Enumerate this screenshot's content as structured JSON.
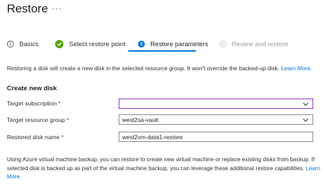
{
  "header": {
    "title": "Restore",
    "more_label": "···"
  },
  "steps": [
    {
      "number": "1",
      "label": "Basics",
      "state": "pending"
    },
    {
      "number": "",
      "label": "Select restore point",
      "state": "done"
    },
    {
      "number": "3",
      "label": "Restore parameters",
      "state": "active"
    },
    {
      "number": "4",
      "label": "Review and restore",
      "state": "disabled"
    }
  ],
  "info": {
    "text": "Restoring a disk will create a new disk in the selected resource group. It won't override the backed-up disk.",
    "link": "Learn More."
  },
  "section": {
    "title": "Create new disk"
  },
  "form": {
    "subscription": {
      "label": "Target subscription",
      "required": "*",
      "value": ""
    },
    "resource_group": {
      "label": "Target resource group",
      "required": "*",
      "value": "west2sa-vault"
    },
    "disk_name": {
      "label": "Restored disk name",
      "required": "*",
      "value": "west2vm-data1-restore"
    }
  },
  "bottom": {
    "text": "Using Azure virtual machine backup, you can restore to create new virtual machine or replace existing disks from backup. If selected disk is backed up as part of the virtual machine backup, you can leverage these additional restore capabilities.",
    "link": "Learn More."
  },
  "colors": {
    "accent": "#0078d4",
    "success": "#57a300",
    "focus": "#8c35c0",
    "required": "#a4262c"
  },
  "icons": {
    "done_step": "checkmark-icon",
    "dropdown": "chevron-down-icon"
  }
}
